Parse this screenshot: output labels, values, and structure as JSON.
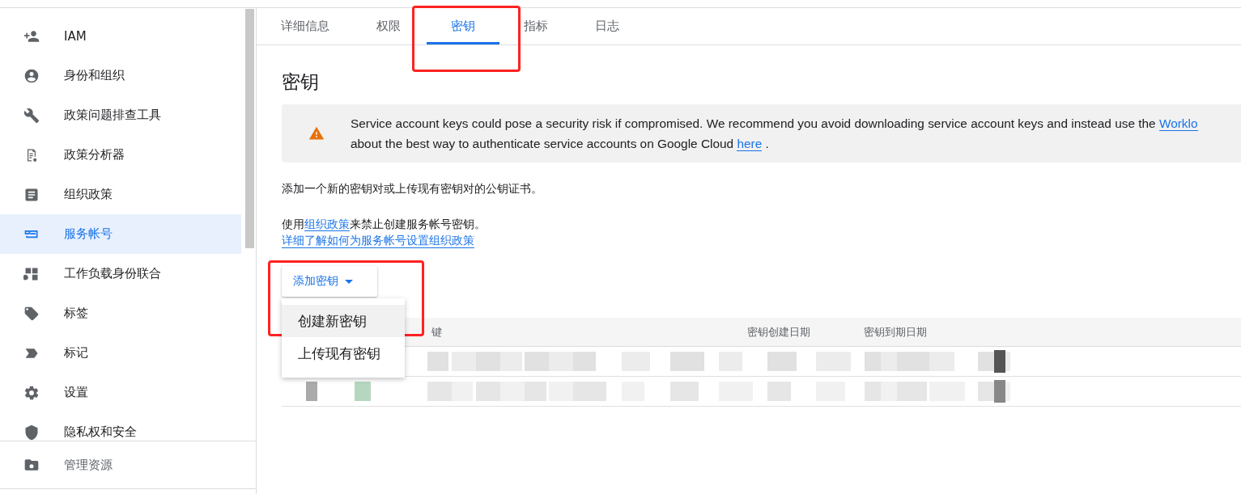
{
  "sidebar": {
    "items": [
      {
        "label": "IAM",
        "selected": false
      },
      {
        "label": "身份和组织",
        "selected": false
      },
      {
        "label": "政策问题排查工具",
        "selected": false
      },
      {
        "label": "政策分析器",
        "selected": false
      },
      {
        "label": "组织政策",
        "selected": false
      },
      {
        "label": "服务帐号",
        "selected": true
      },
      {
        "label": "工作负载身份联合",
        "selected": false
      },
      {
        "label": "标签",
        "selected": false
      },
      {
        "label": "标记",
        "selected": false
      },
      {
        "label": "设置",
        "selected": false
      },
      {
        "label": "隐私权和安全",
        "selected": false
      }
    ],
    "footer": {
      "label": "管理资源"
    }
  },
  "tabs": [
    {
      "label": "详细信息",
      "selected": false,
      "highlighted": false
    },
    {
      "label": "权限",
      "selected": false,
      "highlighted": false
    },
    {
      "label": "密钥",
      "selected": true,
      "highlighted": true
    },
    {
      "label": "指标",
      "selected": false,
      "highlighted": false
    },
    {
      "label": "日志",
      "selected": false,
      "highlighted": false
    }
  ],
  "heading": "密钥",
  "banner": {
    "lines": [
      {
        "text": "Service account keys could pose a security risk if compromised. We recommend you avoid downloading service account keys and instead use the ",
        "link": "Worklo"
      },
      {
        "text": "about the best way to authenticate service accounts on Google Cloud ",
        "link": "here",
        "after": " ."
      }
    ]
  },
  "intro": "添加一个新的密钥对或上传现有密钥对的公钥证书。",
  "policy_line": {
    "before": "使用",
    "link": "组织政策",
    "after": "来禁止创建服务帐号密钥。"
  },
  "learn_more": "详细了解如何为服务帐号设置组织政策",
  "add_button": {
    "label": "添加密钥",
    "highlighted": true
  },
  "menu": [
    {
      "label": "创建新密钥",
      "hovered": true
    },
    {
      "label": "上传现有密钥",
      "hovered": false
    }
  ],
  "table": {
    "columns": [
      "键",
      "密钥创建日期",
      "密钥到期日期"
    ],
    "rows": [
      {
        "kind": "redacted"
      },
      {
        "kind": "redacted"
      }
    ]
  }
}
